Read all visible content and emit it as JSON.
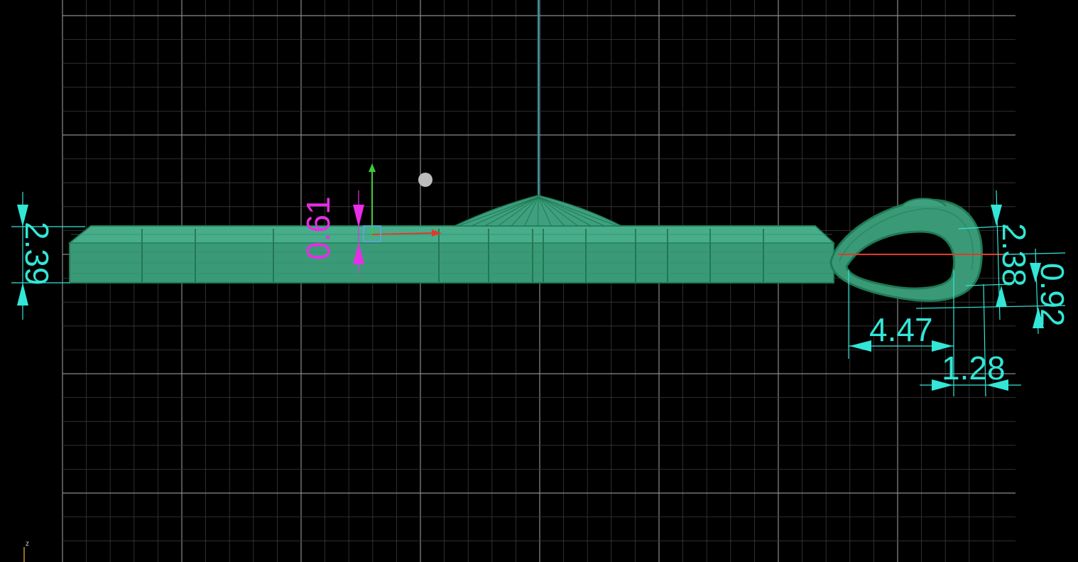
{
  "viewport": {
    "colors": {
      "background": "#000000",
      "grid_minor": "#3a3a3a",
      "grid_major": "#8a8a8a",
      "model_fill": "#3a9a78",
      "model_wire": "#1f7a55",
      "dimension": "#33e6d6",
      "dimension_selected": "#e62ee6",
      "axis_x": "#e03a2a",
      "axis_y": "#3acc3a",
      "axis_z": "#2a9aa8"
    },
    "axis_indicator": {
      "label": "z"
    }
  },
  "dimensions": {
    "plate_height": "2.39",
    "selected_offset": "0.61",
    "loop_height": "2.38",
    "loop_offset": "0.92",
    "loop_width": "4.47",
    "loop_wall": "1.28"
  },
  "icons": {
    "gizmo": "move-gizmo-icon",
    "pivot": "pivot-point-icon"
  }
}
